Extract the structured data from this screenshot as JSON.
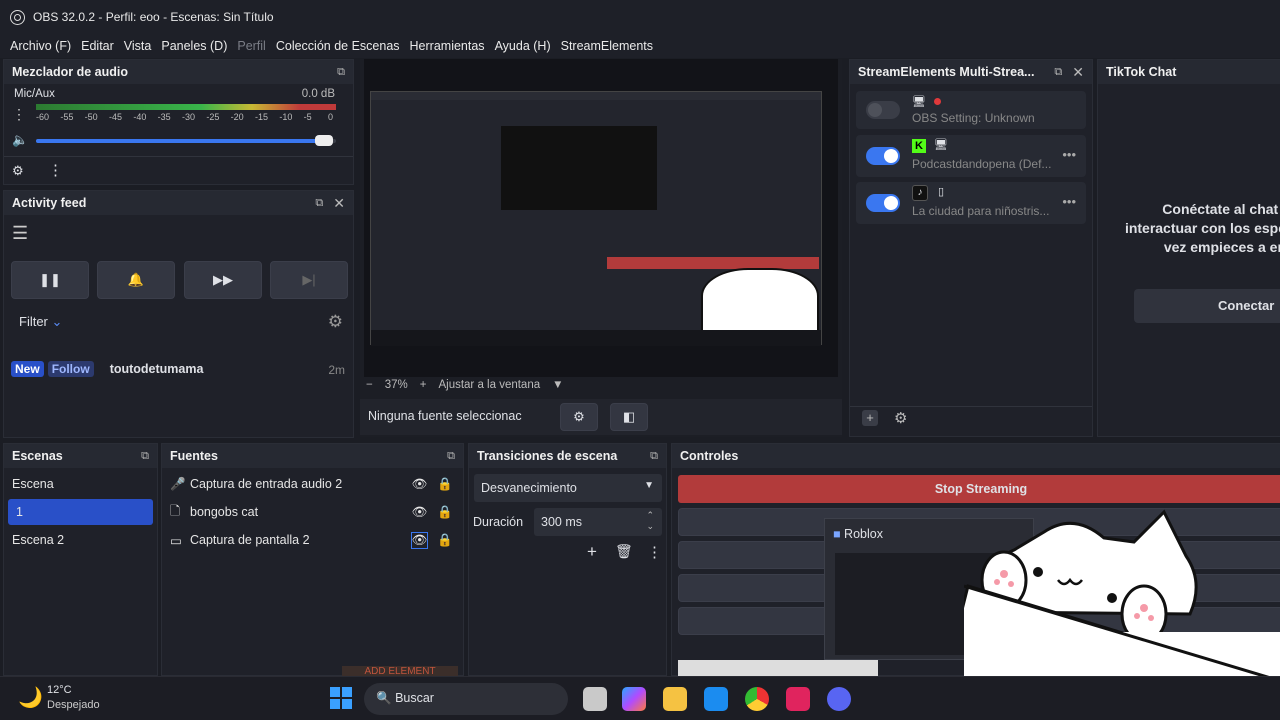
{
  "window": {
    "title": "OBS 32.0.2 - Perfil: eoo - Escenas: Sin Título"
  },
  "menu": [
    "Archivo (F)",
    "Editar",
    "Vista",
    "Paneles (D)",
    "Perfil",
    "Colección de Escenas",
    "Herramientas",
    "Ayuda (H)",
    "StreamElements"
  ],
  "audio": {
    "title": "Mezclador de audio",
    "channel": "Mic/Aux",
    "level": "0.0 dB",
    "ticks": [
      "-60",
      "-55",
      "-50",
      "-45",
      "-40",
      "-35",
      "-30",
      "-25",
      "-20",
      "-15",
      "-10",
      "-5",
      "0"
    ],
    "volume_fraction": 0.97
  },
  "activity": {
    "title": "Activity feed",
    "filter_label": "Filter",
    "feed": {
      "badge_new": "New",
      "badge_type": "Follow",
      "user": "toutodetumama",
      "time": "2m"
    }
  },
  "preview": {
    "zoom": "37%",
    "fit_label": "Ajustar a la ventana",
    "no_source": "Ninguna fuente seleccionac"
  },
  "multistream": {
    "title": "StreamElements Multi-Strea...",
    "items": [
      {
        "label": "OBS Setting: Unknown",
        "on": false
      },
      {
        "label": "Podcastdandopena (Def...",
        "on": true
      },
      {
        "label": "La ciudad para niñostris...",
        "on": true
      }
    ]
  },
  "tiktok": {
    "title": "TikTok Chat",
    "text_line1": "Conéctate al chat l",
    "text_line2": "interactuar con los espe",
    "text_line3": "vez empieces a en",
    "connect": "Conectar"
  },
  "scenes": {
    "title": "Escenas",
    "items": [
      "Escena",
      "1",
      "Escena 2"
    ]
  },
  "sources": {
    "title": "Fuentes",
    "items": [
      "Captura de entrada audio 2",
      "bongobs cat",
      "Captura de pantalla 2"
    ],
    "add_label": "ADD ELEMENT"
  },
  "transitions": {
    "title": "Transiciones de escena",
    "type": "Desvanecimiento",
    "duration_label": "Duración",
    "duration": "300 ms"
  },
  "controls": {
    "title": "Controles",
    "stop": "Stop Streaming",
    "overlay_title": "Roblox"
  },
  "taskbar": {
    "temp": "12°C",
    "weather": "Despejado",
    "search": "Buscar"
  },
  "colors": {
    "accent": "#2950c8",
    "stop": "#b23b3b",
    "toggle": "#3a77f0"
  }
}
